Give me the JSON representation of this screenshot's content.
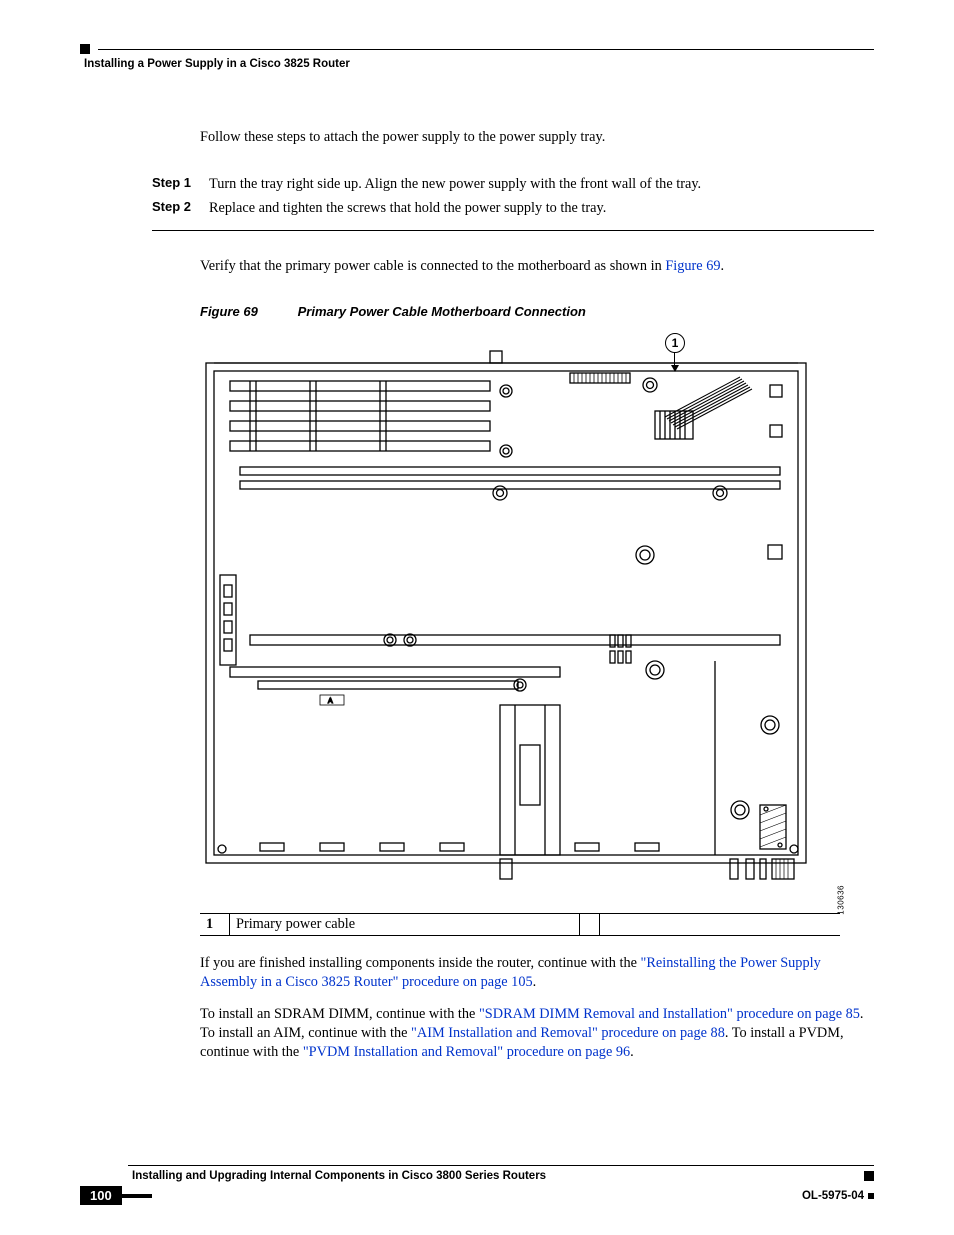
{
  "header": {
    "section_title": "Installing a Power Supply in a Cisco 3825 Router"
  },
  "body": {
    "intro": "Follow these steps to attach the power supply to the power supply tray.",
    "steps": [
      {
        "label": "Step 1",
        "text": "Turn the tray right side up. Align the new power supply with the front wall of the tray."
      },
      {
        "label": "Step 2",
        "text": "Replace and tighten the screws that hold the power supply to the tray."
      }
    ],
    "verify_pre": "Verify that the primary power cable is connected to the motherboard as shown in ",
    "verify_link": "Figure 69",
    "verify_post": ".",
    "figure": {
      "number": "Figure 69",
      "title": "Primary Power Cable Motherboard Connection",
      "callout": "1",
      "id": "130636"
    },
    "key": {
      "num": "1",
      "text": "Primary power cable"
    },
    "p1_a": "If you are finished installing components inside the router, continue with the ",
    "p1_link": "\"Reinstalling the Power Supply Assembly in a Cisco 3825 Router\" procedure on page 105",
    "p1_b": ".",
    "p2_a": "To install an SDRAM DIMM, continue with the ",
    "p2_link1": "\"SDRAM DIMM Removal and Installation\" procedure on page 85",
    "p2_b": ". To install an AIM, continue with the ",
    "p2_link2": "\"AIM Installation and Removal\" procedure on page 88",
    "p2_c": ". To install a PVDM, continue with the ",
    "p2_link3": "\"PVDM Installation and Removal\" procedure on page 96",
    "p2_d": "."
  },
  "footer": {
    "book_title": "Installing and Upgrading Internal Components in Cisco 3800 Series Routers",
    "page_number": "100",
    "doc_id": "OL-5975-04"
  }
}
